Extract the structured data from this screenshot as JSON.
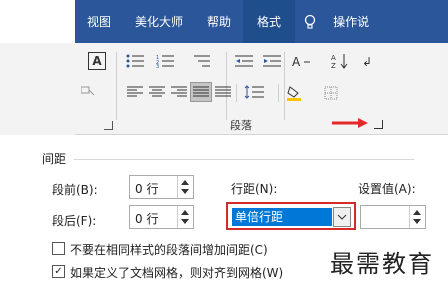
{
  "ribbon": {
    "tabs": [
      {
        "label": "视图"
      },
      {
        "label": "美化大师"
      },
      {
        "label": "帮助"
      },
      {
        "label": "格式"
      },
      {
        "label": "操作说"
      }
    ],
    "bulb_icon": "lightbulb-icon",
    "group_label": "段落",
    "accent": "#2b579a"
  },
  "dialog": {
    "section_title": "间距",
    "before_label": "段前(B):",
    "before_value": "0 行",
    "after_label": "段后(F):",
    "after_value": "0 行",
    "line_spacing_label": "行距(N):",
    "line_spacing_value": "单倍行距",
    "set_value_label": "设置值(A):",
    "checkbox1_label": "不要在相同样式的段落间增加间距(C)",
    "checkbox1_checked": false,
    "checkbox2_label": "如果定义了文档网格，则对齐到网格(W)",
    "checkbox2_checked": true,
    "highlight_color": "#d62b2b"
  },
  "watermark": "最需教育"
}
